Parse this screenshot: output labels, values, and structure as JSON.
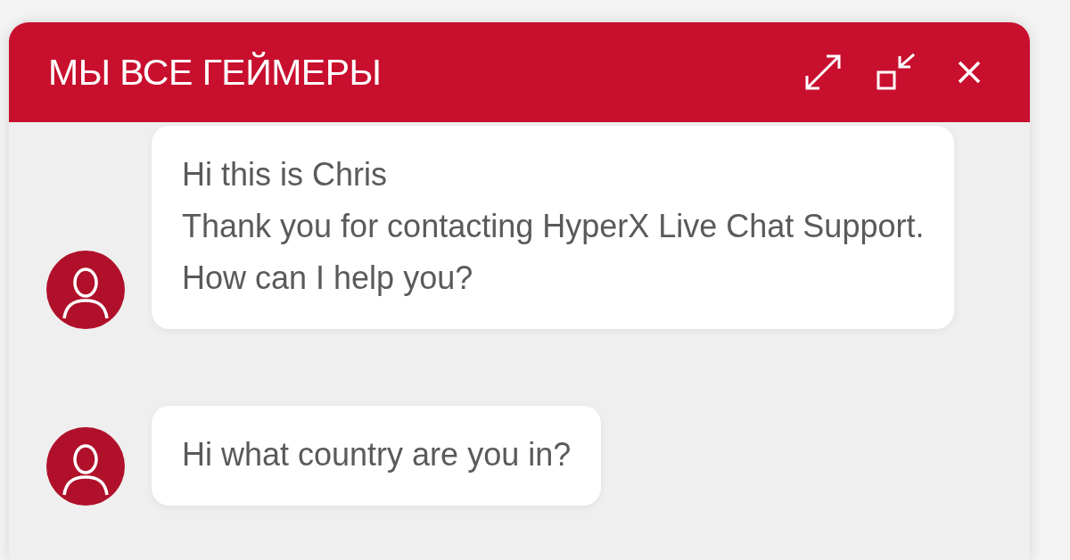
{
  "header": {
    "title": "МЫ ВСЕ ГЕЙМЕРЫ"
  },
  "messages": [
    {
      "lines": [
        "Hi this is Chris",
        "Thank you for contacting HyperX Live Chat Support.",
        "How can I help you?"
      ]
    },
    {
      "lines": [
        "Hi what country are you in?"
      ]
    }
  ]
}
